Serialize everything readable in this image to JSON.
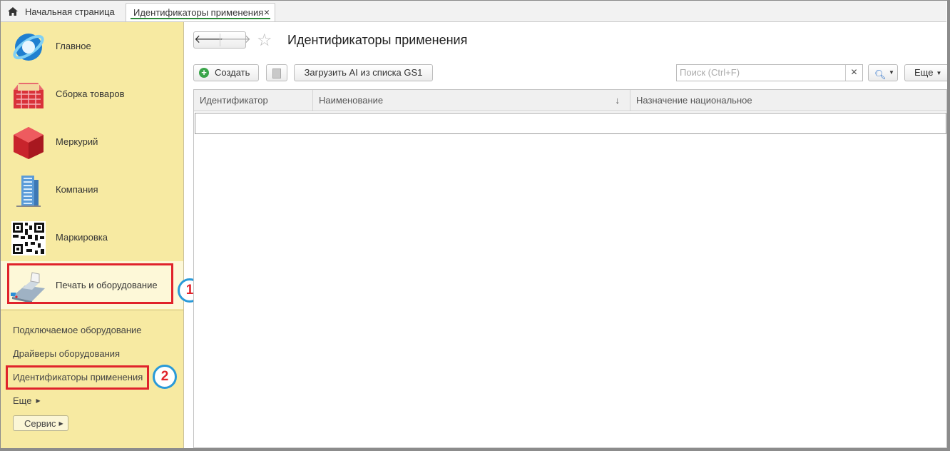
{
  "tabs": {
    "home_label": "Начальная страница",
    "active_label": "Идентификаторы применения",
    "close_symbol": "×"
  },
  "sidebar": {
    "sections": [
      {
        "label": "Главное",
        "icon": "main-globe-icon"
      },
      {
        "label": "Сборка товаров",
        "icon": "goods-basket-icon"
      },
      {
        "label": "Меркурий",
        "icon": "mercury-cube-icon"
      },
      {
        "label": "Компания",
        "icon": "company-building-icon"
      },
      {
        "label": "Маркировка",
        "icon": "qr-code-icon"
      },
      {
        "label": "Печать и оборудование",
        "icon": "cash-register-icon"
      }
    ],
    "sublinks": [
      {
        "label": "Подключаемое оборудование"
      },
      {
        "label": "Драйверы оборудования"
      },
      {
        "label": "Идентификаторы применения"
      },
      {
        "label": "Еще"
      }
    ],
    "service_label": "Сервис"
  },
  "annotations": {
    "badge1": "1",
    "badge2": "2",
    "highlight_color": "#e0232b",
    "badge_color": "#2a9ad8"
  },
  "main": {
    "title": "Идентификаторы применения",
    "toolbar": {
      "create_label": "Создать",
      "load_label": "Загрузить AI из списка GS1",
      "search_placeholder": "Поиск (Ctrl+F)",
      "more_label": "Еще"
    },
    "table": {
      "columns": [
        "Идентификатор",
        "Наименование",
        "Назначение национальное"
      ],
      "sort_indicator": "↓",
      "rows": []
    }
  },
  "colors": {
    "sidebar_bg": "#f7eaa2",
    "active_section_bg": "#fdf8d8",
    "active_tab_underline": "#2c8a3a",
    "create_icon": "#3aa54a"
  }
}
